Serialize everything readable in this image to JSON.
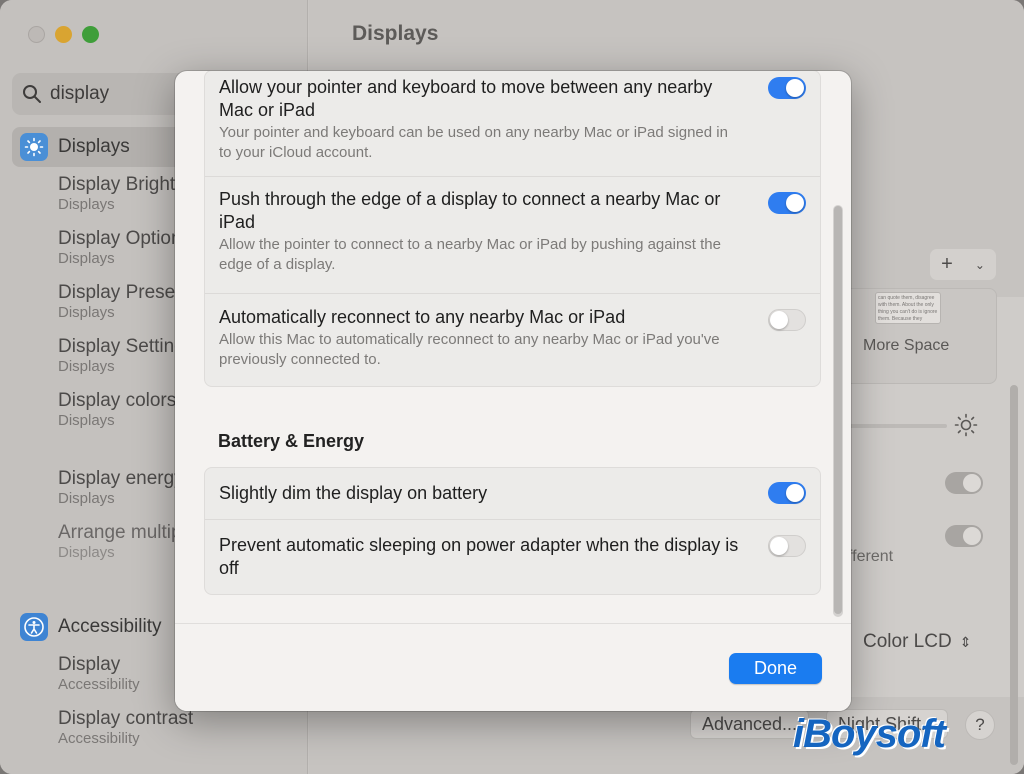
{
  "window": {
    "title": "Displays"
  },
  "sidebar": {
    "search_value": "display",
    "items": [
      {
        "label": "Displays",
        "icon": "sun-icon"
      },
      {
        "label": "Display Brightness",
        "sub": "Displays"
      },
      {
        "label": "Display Options",
        "sub": "Displays"
      },
      {
        "label": "Display Presets",
        "sub": "Displays"
      },
      {
        "label": "Display Settings",
        "sub": "Displays"
      },
      {
        "label": "Display colors calibration",
        "sub": "Displays"
      },
      {
        "label": "Display energy",
        "sub": "Displays"
      },
      {
        "label": "Arrange multiple displays",
        "sub": "Displays"
      },
      {
        "label": "Accessibility",
        "icon": "accessibility-icon"
      },
      {
        "label": "Display",
        "sub": "Accessibility"
      },
      {
        "label": "Display contrast",
        "sub": "Accessibility"
      }
    ]
  },
  "background": {
    "plus_label": "+",
    "more_space": "More Space",
    "different_fragment": "fferent",
    "color_profile": "Color LCD",
    "advanced_button": "Advanced...",
    "night_shift_button": "Night Shift...",
    "help_label": "?",
    "thumb_text": "can quote them, disagree with them. About the only thing you can't do is ignore them. Because they change things."
  },
  "sheet": {
    "group1": [
      {
        "title": "Allow your pointer and keyboard to move between any nearby Mac or iPad",
        "desc": "Your pointer and keyboard can be used on any nearby Mac or iPad signed in to your iCloud account.",
        "on": true
      },
      {
        "title": "Push through the edge of a display to connect a nearby Mac or iPad",
        "desc": "Allow the pointer to connect to a nearby Mac or iPad by pushing against the edge of a display.",
        "on": true
      },
      {
        "title": "Automatically reconnect to any nearby Mac or iPad",
        "desc": "Allow this Mac to automatically reconnect to any nearby Mac or iPad you've previously connected to.",
        "on": false
      }
    ],
    "battery_section_title": "Battery & Energy",
    "group2": [
      {
        "title": "Slightly dim the display on battery",
        "on": true
      },
      {
        "title": "Prevent automatic sleeping on power adapter when the display is off",
        "on": false
      }
    ],
    "done_label": "Done"
  },
  "watermark": "iBoysoft",
  "colors": {
    "accent": "#1a7cf0",
    "toggle_on": "#2f7df0",
    "toggle_off": "#e3e1df"
  }
}
